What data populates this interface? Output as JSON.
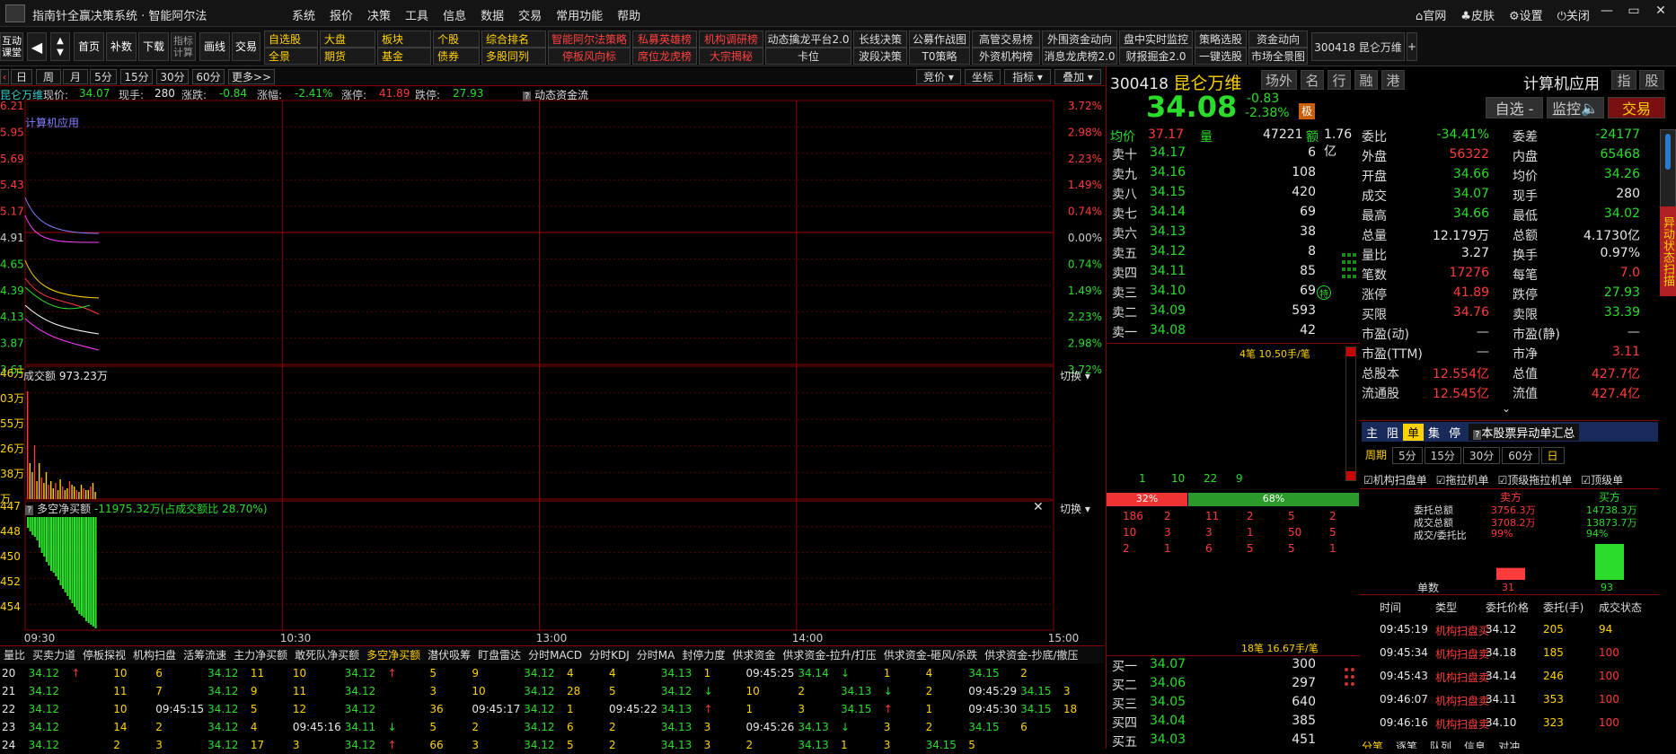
{
  "titlebar": {
    "app_name": "指南针全赢决策系统 · 智能阿尔法",
    "menu": [
      "系统",
      "报价",
      "决策",
      "工具",
      "信息",
      "数据",
      "交易",
      "常用功能",
      "帮助"
    ],
    "right_links": [
      "官网",
      "皮肤",
      "设置",
      "关闭"
    ],
    "win_min": "—",
    "win_restore": "▭",
    "win_close": "✕"
  },
  "toolbar": {
    "big_buttons": [
      "互动课堂",
      "首页",
      "补数",
      "下载",
      "指标计算",
      "画线",
      "交易"
    ],
    "row1": [
      "自选股",
      "大盘",
      "板块",
      "个股",
      "综合排名",
      "智能阿尔法策略",
      "私募英雄榜",
      "机构调研榜",
      "动态擒龙平台2.0",
      "长线决策",
      "公募作战图",
      "高管交易榜",
      "外围资金动向",
      "盘中实时监控",
      "策略选股",
      "资金动向"
    ],
    "row2": [
      "全景",
      "期货",
      "基金",
      "债券",
      "多股同列",
      "停板风向标",
      "席位龙虎榜",
      "大宗揭秘",
      "卡位",
      "波段决策",
      "T0策略",
      "外资机构榜",
      "消息龙虎榜2.0",
      "财报掘金2.0",
      "一键选股",
      "市场全景图"
    ],
    "stock_chip": "300418 昆仑万维"
  },
  "periods": [
    "日",
    "周",
    "月",
    "5分",
    "15分",
    "30分",
    "60分",
    "更多>>"
  ],
  "chart_tools": [
    "竞价",
    "坐标",
    "指标",
    "叠加"
  ],
  "quote_line": {
    "name": "昆仑万维",
    "now_label": "现价:",
    "now": "34.07",
    "hand_label": "现手:",
    "hand": "280",
    "chg_label": "涨跌:",
    "chg": "-0.84",
    "pct_label": "涨幅:",
    "pct": "-2.41%",
    "up_label": "涨停:",
    "up": "41.89",
    "down_label": "跌停:",
    "down": "27.93",
    "flow_title": "动态资金流"
  },
  "price_chart": {
    "sector": "计算机应用",
    "left_labels": [
      "6.21",
      "5.95",
      "5.69",
      "5.43",
      "5.17",
      "4.91",
      "4.65",
      "4.39",
      "4.13",
      "3.87",
      "3.61"
    ],
    "right_labels": [
      "3.72%",
      "2.98%",
      "2.23%",
      "1.49%",
      "0.74%",
      "0.00%",
      "0.74%",
      "1.49%",
      "2.23%",
      "2.98%",
      "3.72%"
    ]
  },
  "volume_chart": {
    "title": "成交额",
    "value": "973.23万",
    "switch": "切换",
    "left_labels": [
      "46万",
      "03万",
      "55万",
      "26万",
      "38万",
      "万"
    ]
  },
  "net_chart": {
    "title": "多空净买额",
    "value": "-11975.32万(占成交额比 28.70%)",
    "switch": "切换",
    "left_labels": [
      "447",
      "448",
      "450",
      "452",
      "454"
    ]
  },
  "time_axis": [
    "09:30",
    "10:30",
    "13:00",
    "14:00",
    "15:00"
  ],
  "bottom_tabs": [
    "量比",
    "买卖力道",
    "停板探视",
    "机构扫盘",
    "活筹流速",
    "主力净买额",
    "敢死队净买额",
    "多空净买额",
    "潜伏吸筹",
    "盯盘雷达",
    "分时MACD",
    "分时KDJ",
    "分时MA",
    "封停力度",
    "供求资金",
    "供求资金-拉升/打压",
    "供求资金-砸风/杀跌",
    "供求资金-抄底/撤压"
  ],
  "bottom_rows": [
    [
      "20",
      "34.12",
      "↑",
      "10",
      "6",
      "34.12",
      "11",
      "10",
      "34.12",
      "↑",
      "5",
      "9",
      "34.12",
      "4",
      "4",
      "34.13",
      "1",
      "09:45:25",
      "34.14",
      "↓",
      "1",
      "4",
      "34.15",
      "2"
    ],
    [
      "21",
      "34.12",
      "",
      "11",
      "7",
      "34.12",
      "9",
      "11",
      "34.12",
      "",
      "3",
      "10",
      "34.12",
      "28",
      "5",
      "34.12",
      "↓",
      "10",
      "2",
      "34.13",
      "↓",
      "2",
      "09:45:29",
      "34.15",
      "3"
    ],
    [
      "22",
      "34.12",
      "",
      "10",
      "09:45:15",
      "34.12",
      "5",
      "12",
      "34.12",
      "",
      "36",
      "09:45:17",
      "34.12",
      "1",
      "09:45:22",
      "34.13",
      "↑",
      "1",
      "3",
      "34.15",
      "↑",
      "1",
      "09:45:30",
      "34.15",
      "18"
    ],
    [
      "23",
      "34.12",
      "",
      "14",
      "2",
      "34.12",
      "4",
      "09:45:16",
      "34.11",
      "↓",
      "5",
      "2",
      "34.12",
      "6",
      "2",
      "34.13",
      "3",
      "09:45:26",
      "34.13",
      "↓",
      "3",
      "2",
      "34.15",
      "6"
    ],
    [
      "24",
      "34.12",
      "",
      "2",
      "3",
      "34.12",
      "17",
      "3",
      "34.12",
      "↑",
      "66",
      "3",
      "34.12",
      "5",
      "2",
      "34.13",
      "3",
      "2",
      "34.13",
      "1",
      "3",
      "34.15",
      "5"
    ]
  ],
  "stock": {
    "code": "300418",
    "name": "昆仑万维",
    "tags": [
      "场外",
      "名",
      "行",
      "融",
      "港"
    ],
    "price": "34.08",
    "chg": "-0.83",
    "pct": "-2.38%",
    "badge": "极",
    "industry": "计算机应用",
    "ind_tags": [
      "指",
      "股"
    ],
    "btn_watch": "自选 -",
    "btn_monitor": "监控",
    "btn_trade": "交易"
  },
  "avg_line": {
    "avg_label": "均价",
    "avg": "37.17",
    "vol_label": "量",
    "vol": "47221",
    "amt_label": "额",
    "amt": "1.76亿"
  },
  "sells": [
    [
      "卖十",
      "34.17",
      "6"
    ],
    [
      "卖九",
      "34.16",
      "108"
    ],
    [
      "卖八",
      "34.15",
      "420"
    ],
    [
      "卖七",
      "34.14",
      "69"
    ],
    [
      "卖六",
      "34.13",
      "38"
    ],
    [
      "卖五",
      "34.12",
      "8"
    ],
    [
      "卖四",
      "34.11",
      "85"
    ],
    [
      "卖三",
      "34.10",
      "69"
    ],
    [
      "卖二",
      "34.09",
      "593"
    ],
    [
      "卖一",
      "34.08",
      "42"
    ]
  ],
  "buys": [
    [
      "买一",
      "34.07",
      "300"
    ],
    [
      "买二",
      "34.06",
      "297"
    ],
    [
      "买三",
      "34.05",
      "640"
    ],
    [
      "买四",
      "34.04",
      "385"
    ],
    [
      "买五",
      "34.03",
      "451"
    ]
  ],
  "fin": [
    [
      "委比",
      "-34.41%",
      "委差",
      "-24177"
    ],
    [
      "外盘",
      "56322",
      "内盘",
      "65468"
    ],
    [
      "开盘",
      "34.66",
      "均价",
      "34.26"
    ],
    [
      "成交",
      "34.07",
      "现手",
      "280"
    ],
    [
      "最高",
      "34.66",
      "最低",
      "34.02"
    ],
    [
      "总量",
      "12.179万",
      "总额",
      "4.1730亿"
    ],
    [
      "量比",
      "3.27",
      "换手",
      "0.97%"
    ],
    [
      "笔数",
      "17276",
      "每笔",
      "7.0"
    ],
    [
      "涨停",
      "41.89",
      "跌停",
      "27.93"
    ],
    [
      "买限",
      "34.76",
      "卖限",
      "33.39"
    ],
    [
      "市盈(动)",
      "—",
      "市盈(静)",
      "—"
    ],
    [
      "市盈(TTM)",
      "—",
      "市净",
      "3.11"
    ],
    [
      "总股本",
      "12.554亿",
      "总值",
      "427.7亿"
    ],
    [
      "流通股",
      "12.545亿",
      "流值",
      "427.4亿"
    ]
  ],
  "orders": {
    "top_note": "4笔 10.50手/笔",
    "counts": [
      "1",
      "10",
      "22",
      "9"
    ],
    "sell_pct": "32%",
    "buy_pct": "68%",
    "rows": [
      [
        "186",
        "2",
        "11",
        "2",
        "5",
        "2"
      ],
      [
        "10",
        "3",
        "3",
        "1",
        "50",
        "5"
      ],
      [
        "2",
        "1",
        "6",
        "5",
        "5",
        "1"
      ]
    ],
    "bottom_note": "18笔 16.67手/笔"
  },
  "right_tabs": [
    "主",
    "阻",
    "单",
    "集",
    "停"
  ],
  "abn_title": "本股票异动单汇总",
  "periods2_label": "周期",
  "periods2": [
    "5分",
    "15分",
    "30分",
    "60分",
    "日"
  ],
  "checks": [
    "机构扫盘单",
    "拖拉机单",
    "顶级拖拉机单",
    "顶级单"
  ],
  "summary": {
    "sell_label": "卖方",
    "buy_label": "买方",
    "rows": [
      [
        "委托总额",
        "3756.3万",
        "14738.3万"
      ],
      [
        "成交总额",
        "3708.2万",
        "13873.7万"
      ],
      [
        "成交/委托比",
        "99%",
        "94%"
      ]
    ],
    "count_label": "单数",
    "sell_count": "31",
    "buy_count": "93",
    "sell_ratio": 0.99,
    "buy_ratio": 0.94
  },
  "trade_head": [
    "时间",
    "类型",
    "委托价格",
    "委托(手)",
    "成交状态"
  ],
  "trades": [
    [
      "09:45:19",
      "机构扫盘买",
      "34.12",
      "205",
      "94"
    ],
    [
      "09:45:34",
      "机构扫盘卖",
      "34.18",
      "185",
      "100"
    ],
    [
      "09:45:43",
      "机构扫盘卖",
      "34.14",
      "246",
      "100"
    ],
    [
      "09:46:07",
      "机构扫盘卖",
      "34.11",
      "353",
      "100"
    ],
    [
      "09:46:16",
      "机构扫盘卖",
      "34.10",
      "323",
      "100"
    ]
  ],
  "bottom_right_tabs": [
    "分笔",
    "逐笔",
    "队列",
    "信息",
    "对冲"
  ],
  "side_tab": "异动状态扫描",
  "colors": {
    "up": "#ff3b3b",
    "down": "#2bdc2b",
    "accent": "#ffd200",
    "border": "#8a0000"
  }
}
